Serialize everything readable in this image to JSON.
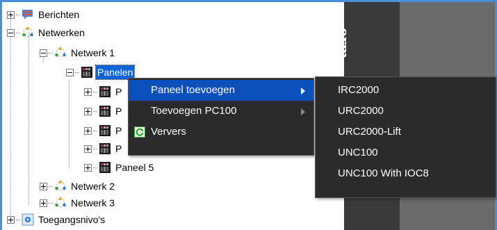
{
  "tree": {
    "nodes": [
      {
        "label": "Berichten",
        "icon": "message-icon"
      },
      {
        "label": "Netwerken",
        "icon": "network-icon"
      },
      {
        "label": "Netwerk 1",
        "icon": "network-icon"
      },
      {
        "label": "Panelen",
        "icon": "panel-icon",
        "selected": true
      },
      {
        "label": "P",
        "icon": "panel-icon"
      },
      {
        "label": "P",
        "icon": "panel-icon"
      },
      {
        "label": "P",
        "icon": "panel-icon"
      },
      {
        "label": "P",
        "icon": "panel-icon"
      },
      {
        "label": "Paneel 5",
        "icon": "panel-icon"
      },
      {
        "label": "Netwerk 2",
        "icon": "network-icon"
      },
      {
        "label": "Netwerk 3",
        "icon": "network-icon"
      },
      {
        "label": "Toegangsnivo's",
        "icon": "access-level-icon"
      }
    ]
  },
  "side_panel": {
    "vertical_text": "erm"
  },
  "context_menu": {
    "items": [
      {
        "label": "Paneel toevoegen",
        "has_submenu": true,
        "active": true
      },
      {
        "label": "Toevoegen PC100",
        "has_submenu": true
      },
      {
        "label": "Ververs",
        "icon": "refresh-icon"
      }
    ]
  },
  "submenu": {
    "items": [
      "IRC2000",
      "URC2000",
      "URC2000-Lift",
      "UNC100",
      "UNC100 With IOC8"
    ]
  },
  "colors": {
    "frame": "#4a8fd6",
    "selection": "#0a64d6",
    "menu_bg": "#2b2b2b",
    "menu_active": "#0a50b8"
  }
}
